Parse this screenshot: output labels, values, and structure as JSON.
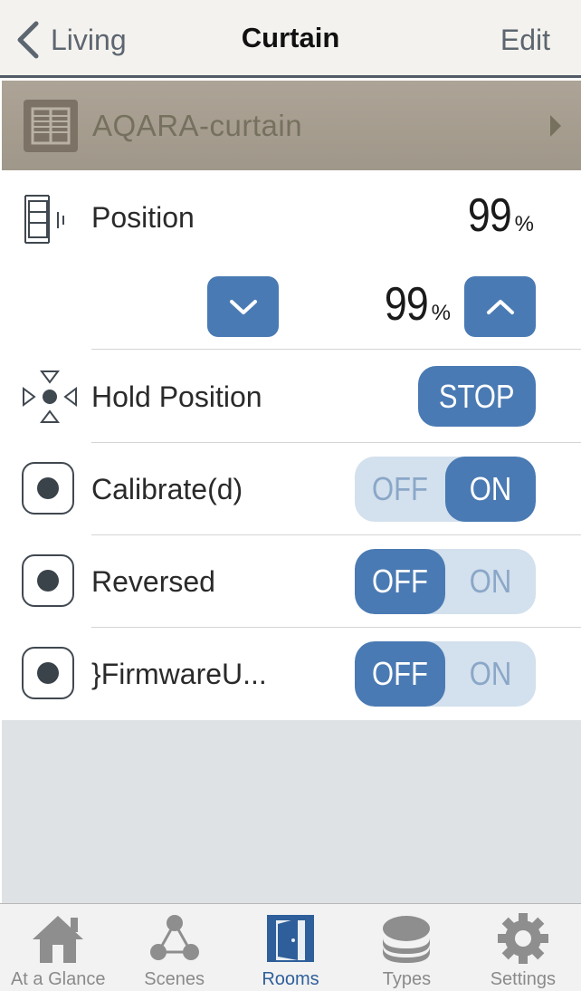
{
  "nav": {
    "back_label": "Living",
    "title": "Curtain",
    "edit_label": "Edit"
  },
  "accessory": {
    "name": "AQARA-curtain"
  },
  "position": {
    "label": "Position",
    "current_value": "99",
    "current_unit": "%",
    "target_value": "99",
    "target_unit": "%"
  },
  "hold": {
    "label": "Hold Position",
    "button_label": "STOP"
  },
  "toggles": [
    {
      "label": "Calibrate(d)",
      "off_label": "OFF",
      "on_label": "ON",
      "state": "on"
    },
    {
      "label": "Reversed",
      "off_label": "OFF",
      "on_label": "ON",
      "state": "off"
    },
    {
      "label": "}FirmwareU...",
      "off_label": "OFF",
      "on_label": "ON",
      "state": "off"
    }
  ],
  "tabbar": {
    "items": [
      {
        "label": "At a Glance",
        "icon": "house-icon",
        "active": false
      },
      {
        "label": "Scenes",
        "icon": "scenes-icon",
        "active": false
      },
      {
        "label": "Rooms",
        "icon": "door-icon",
        "active": true
      },
      {
        "label": "Types",
        "icon": "layers-icon",
        "active": false
      },
      {
        "label": "Settings",
        "icon": "gear-icon",
        "active": false
      }
    ]
  },
  "colors": {
    "accent": "#4a7ab3",
    "toggle_inactive_bg": "#d3e0ed",
    "header_bg": "#a59c8e",
    "tab_active": "#2f5f9a"
  }
}
